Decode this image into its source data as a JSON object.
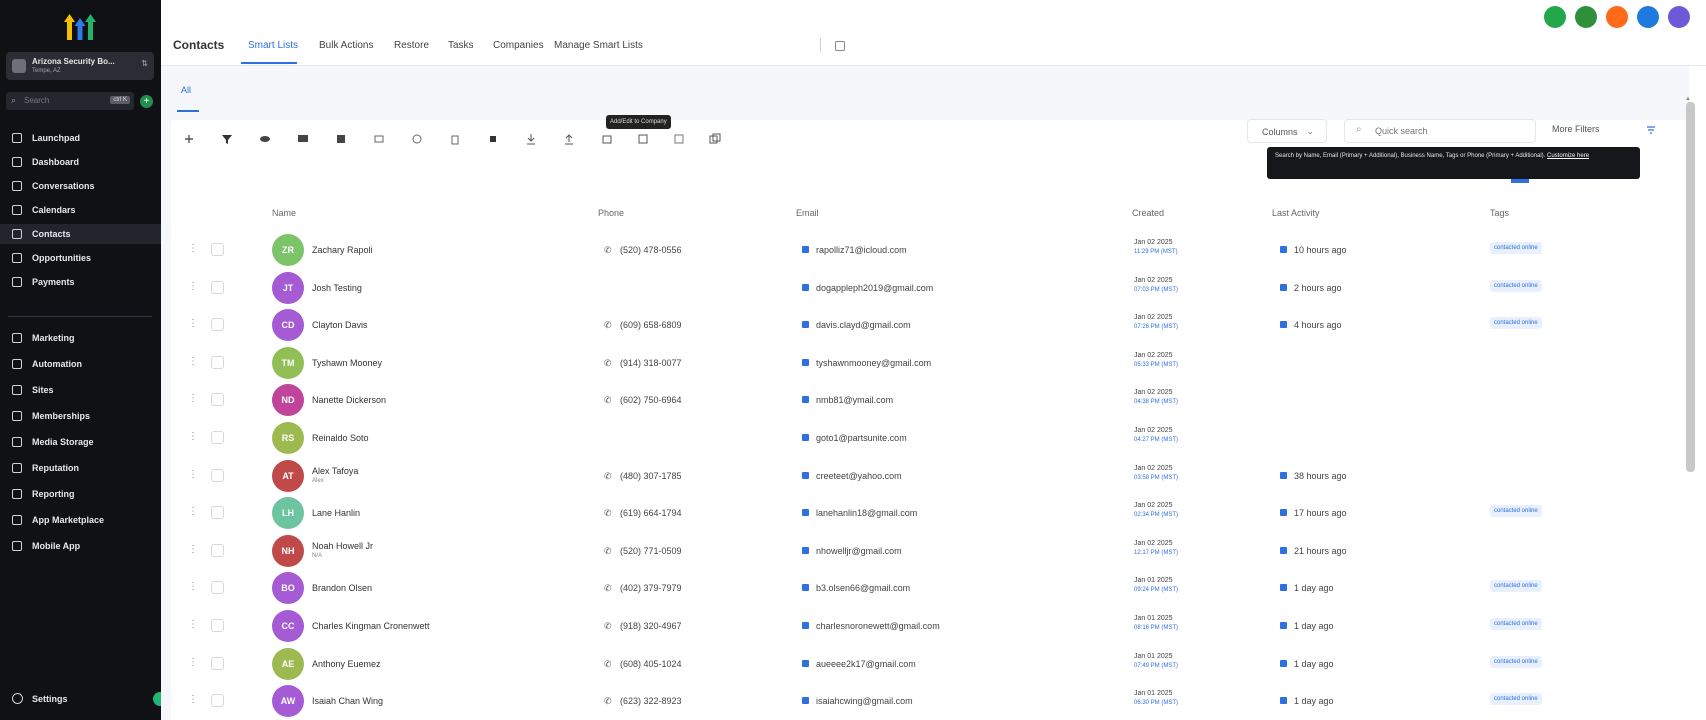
{
  "sidebar": {
    "account_name": "Arizona Security Bo...",
    "account_sub": "Tempe, AZ",
    "search_placeholder": "Search",
    "search_shortcut": "ctrl K",
    "items": [
      {
        "label": "Launchpad",
        "icon": "rocket-icon"
      },
      {
        "label": "Dashboard",
        "icon": "dashboard-icon"
      },
      {
        "label": "Conversations",
        "icon": "chat-icon"
      },
      {
        "label": "Calendars",
        "icon": "calendar-icon"
      },
      {
        "label": "Contacts",
        "icon": "contacts-icon",
        "active": true
      },
      {
        "label": "Opportunities",
        "icon": "funnel-icon"
      },
      {
        "label": "Payments",
        "icon": "payments-icon"
      },
      {
        "label": "Marketing",
        "icon": "send-icon"
      },
      {
        "label": "Automation",
        "icon": "automation-icon"
      },
      {
        "label": "Sites",
        "icon": "sites-icon"
      },
      {
        "label": "Memberships",
        "icon": "memberships-icon"
      },
      {
        "label": "Media Storage",
        "icon": "media-icon"
      },
      {
        "label": "Reputation",
        "icon": "star-icon"
      },
      {
        "label": "Reporting",
        "icon": "chart-icon"
      },
      {
        "label": "App Marketplace",
        "icon": "marketplace-icon"
      },
      {
        "label": "Mobile App",
        "icon": "mobile-icon"
      }
    ],
    "settings_label": "Settings"
  },
  "header": {
    "title": "Contacts",
    "tabs": [
      "Smart Lists",
      "Bulk Actions",
      "Restore",
      "Tasks",
      "Companies",
      "Manage Smart Lists"
    ],
    "top_icon_colors": [
      "#22a84a",
      "#2f8f3a",
      "#ff6a1a",
      "#1f7ae0",
      "#6c5ad8"
    ]
  },
  "subtab": "All",
  "toolbar": {
    "tooltip": "Add/Edit to Company",
    "columns_label": "Columns",
    "search_placeholder": "Quick search",
    "more_filters_label": "More Filters",
    "search_tooltip": "Search by Name, Email (Primary + Additional), Business Name, Tags or Phone (Primary + Additional).",
    "search_tooltip_link": "Customize here"
  },
  "table": {
    "headers": {
      "name": "Name",
      "phone": "Phone",
      "email": "Email",
      "created": "Created",
      "activity": "Last Activity",
      "tags": "Tags"
    },
    "rows": [
      {
        "initials": "ZR",
        "color": "#7cc36a",
        "name": "Zachary Rapoli",
        "sub": "",
        "phone": "(520) 478-0556",
        "email": "rapolliz71@icloud.com",
        "date": "Jan 02 2025",
        "time": "11:29 PM (MST)",
        "activity": "10 hours ago",
        "tag": "contacted online"
      },
      {
        "initials": "JT",
        "color": "#a55bd3",
        "name": "Josh Testing",
        "sub": "",
        "phone": "",
        "email": "dogappleph2019@gmail.com",
        "date": "Jan 02 2025",
        "time": "07:03 PM (MST)",
        "activity": "2 hours ago",
        "tag": "contacted online"
      },
      {
        "initials": "CD",
        "color": "#a55bd3",
        "name": "Clayton Davis",
        "sub": "",
        "phone": "(609) 658-6809",
        "email": "davis.clayd@gmail.com",
        "date": "Jan 02 2025",
        "time": "07:26 PM (MST)",
        "activity": "4 hours ago",
        "tag": "contacted online"
      },
      {
        "initials": "TM",
        "color": "#8fbf55",
        "name": "Tyshawn Mooney",
        "sub": "",
        "phone": "(914) 318-0077",
        "email": "tyshawnmooney@gmail.com",
        "date": "Jan 02 2025",
        "time": "05:33 PM (MST)",
        "activity": "",
        "tag": ""
      },
      {
        "initials": "ND",
        "color": "#c0449a",
        "name": "Nanette Dickerson",
        "sub": "",
        "phone": "(602) 750-6964",
        "email": "nmb81@ymail.com",
        "date": "Jan 02 2025",
        "time": "04:38 PM (MST)",
        "activity": "",
        "tag": ""
      },
      {
        "initials": "RS",
        "color": "#9dba50",
        "name": "Reinaldo Soto",
        "sub": "",
        "phone": "",
        "email": "goto1@partsunite.com",
        "date": "Jan 02 2025",
        "time": "04:27 PM (MST)",
        "activity": "",
        "tag": ""
      },
      {
        "initials": "AT",
        "color": "#c04a4a",
        "name": "Alex Tafoya",
        "sub": "Alex",
        "phone": "(480) 307-1785",
        "email": "creeteet@yahoo.com",
        "date": "Jan 02 2025",
        "time": "03:58 PM (MST)",
        "activity": "38 hours ago",
        "tag": ""
      },
      {
        "initials": "LH",
        "color": "#6cc4a0",
        "name": "Lane Hanlin",
        "sub": "",
        "phone": "(619) 664-1794",
        "email": "lanehanlin18@gmail.com",
        "date": "Jan 02 2025",
        "time": "02:34 PM (MST)",
        "activity": "17 hours ago",
        "tag": "contacted online"
      },
      {
        "initials": "NH",
        "color": "#c04a4a",
        "name": "Noah Howell Jr",
        "sub": "N/A",
        "phone": "(520) 771-0509",
        "email": "nhowelljr@gmail.com",
        "date": "Jan 02 2025",
        "time": "12:17 PM (MST)",
        "activity": "21 hours ago",
        "tag": ""
      },
      {
        "initials": "BO",
        "color": "#a55bd3",
        "name": "Brandon Olsen",
        "sub": "",
        "phone": "(402) 379-7979",
        "email": "b3.olsen66@gmail.com",
        "date": "Jan 01 2025",
        "time": "09:24 PM (MST)",
        "activity": "1 day ago",
        "tag": "contacted online"
      },
      {
        "initials": "CC",
        "color": "#a55bd3",
        "name": "Charles Kingman Cronenwett",
        "sub": "",
        "phone": "(918) 320-4967",
        "email": "charlesnoronewett@gmail.com",
        "date": "Jan 01 2025",
        "time": "08:16 PM (MST)",
        "activity": "1 day ago",
        "tag": "contacted online"
      },
      {
        "initials": "AE",
        "color": "#9dba50",
        "name": "Anthony Euemez",
        "sub": "",
        "phone": "(608) 405-1024",
        "email": "aueeee2k17@gmail.com",
        "date": "Jan 01 2025",
        "time": "07:49 PM (MST)",
        "activity": "1 day ago",
        "tag": "contacted online"
      },
      {
        "initials": "AW",
        "color": "#a55bd3",
        "name": "Isaiah Chan Wing",
        "sub": "",
        "phone": "(623) 322-8923",
        "email": "isaiahcwing@gmail.com",
        "date": "Jan 01 2025",
        "time": "06:30 PM (MST)",
        "activity": "1 day ago",
        "tag": "contacted online"
      }
    ]
  }
}
